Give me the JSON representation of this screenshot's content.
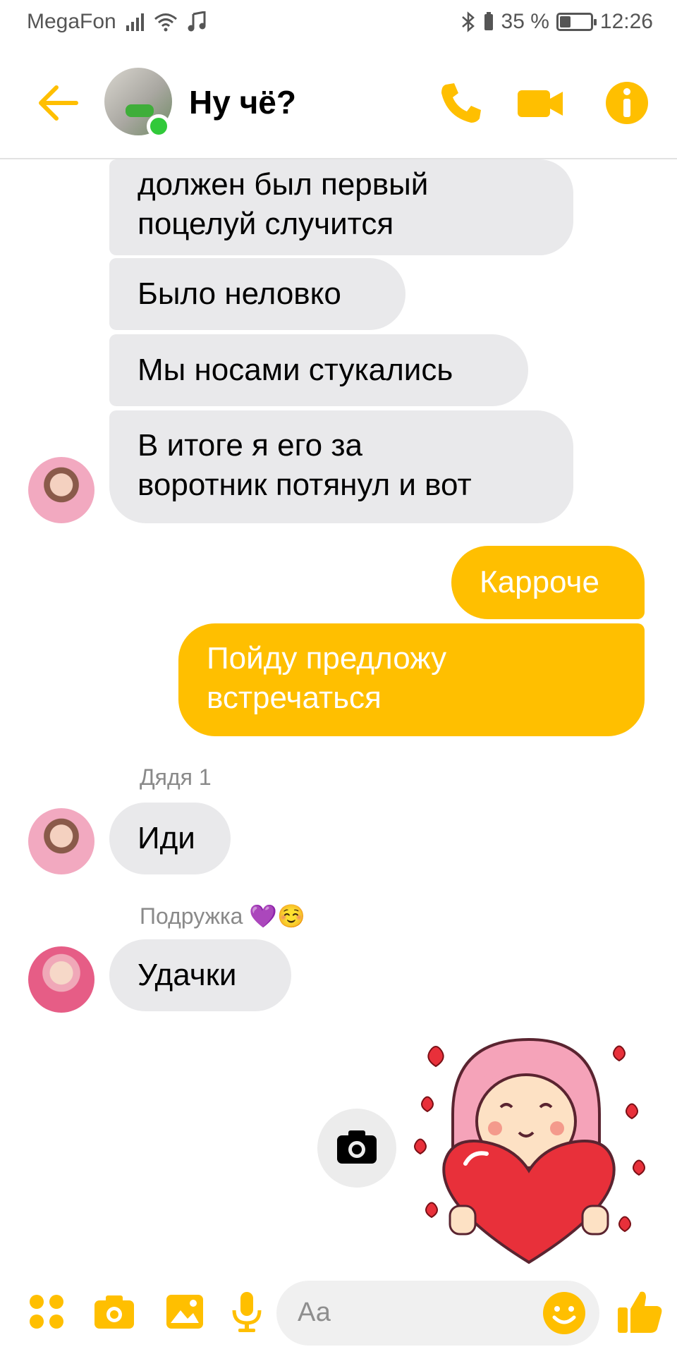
{
  "status_bar": {
    "carrier": "MegaFon",
    "battery_percent": "35 %",
    "battery_level": 0.35,
    "time": "12:26"
  },
  "header": {
    "title": "Ну чё?",
    "icons": [
      "back-arrow-icon",
      "phone-icon",
      "video-camera-icon",
      "info-icon"
    ]
  },
  "messages": [
    {
      "text_line1": "должен был первый",
      "text_line2": "поцелуй случится"
    },
    {
      "text": "Было неловко"
    },
    {
      "text": "Мы носами стукались"
    },
    {
      "text_line1": "В итоге я его за",
      "text_line2": "воротник потянул и вот"
    },
    {
      "text": "Карроче"
    },
    {
      "text_line1": "Пойду предложу",
      "text_line2": "встречаться"
    },
    {
      "sender": "Дядя 1",
      "text": "Иди"
    },
    {
      "sender": "Подружка 💜☺️",
      "text": "Удачки"
    }
  ],
  "composer": {
    "placeholder": "Аа",
    "icons": [
      "menu-dots-icon",
      "camera-icon",
      "gallery-icon",
      "microphone-icon",
      "emoji-icon",
      "thumbs-up-icon"
    ]
  },
  "colors": {
    "accent": "#ffbf00",
    "incoming_bubble": "#e9e9eb",
    "online": "#31c93a"
  }
}
